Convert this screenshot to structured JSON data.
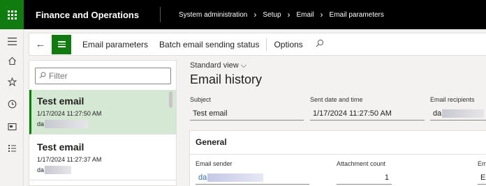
{
  "topbar": {
    "app_name": "Finance and Operations",
    "breadcrumbs": [
      "System administration",
      "Setup",
      "Email",
      "Email parameters"
    ]
  },
  "leftnav": {
    "icons": [
      "hamburger-icon",
      "home-icon",
      "star-icon",
      "clock-icon",
      "workspace-icon",
      "list-icon"
    ]
  },
  "actionpane": {
    "actions": [
      "Email parameters",
      "Batch email sending status",
      "Options"
    ]
  },
  "list": {
    "filter_placeholder": "Filter",
    "items": [
      {
        "title": "Test email",
        "datetime": "1/17/2024 11:27:50 AM",
        "email_prefix": "da",
        "selected": true
      },
      {
        "title": "Test email",
        "datetime": "1/17/2024 11:27:37 AM",
        "email_prefix": "da",
        "selected": false
      }
    ]
  },
  "main": {
    "view_label": "Standard view",
    "page_title": "Email history",
    "fields": {
      "subject_label": "Subject",
      "subject_value": "Test email",
      "sent_label": "Sent date and time",
      "sent_value": "1/17/2024 11:27:50 AM",
      "recipients_label": "Email recipients",
      "recipients_value": "da"
    },
    "general": {
      "title": "General",
      "sender_label": "Email sender",
      "sender_value": "da",
      "attachment_label": "Attachment count",
      "attachment_value": "1",
      "partial_label": "Em",
      "partial_value": "Ex"
    }
  },
  "colors": {
    "brand_green": "#107c10",
    "selected_bg": "#d5e8d4"
  }
}
